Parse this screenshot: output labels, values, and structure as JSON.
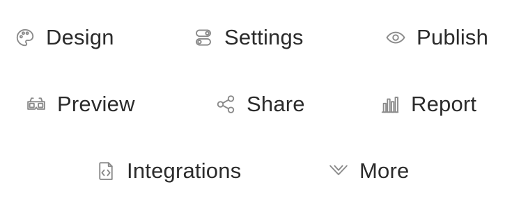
{
  "nav": {
    "items": [
      {
        "label": "Design",
        "icon": "palette-icon"
      },
      {
        "label": "Settings",
        "icon": "toggles-icon"
      },
      {
        "label": "Publish",
        "icon": "eye-icon"
      },
      {
        "label": "Preview",
        "icon": "3d-glasses-icon"
      },
      {
        "label": "Share",
        "icon": "share-nodes-icon"
      },
      {
        "label": "Report",
        "icon": "bar-chart-icon"
      },
      {
        "label": "Integrations",
        "icon": "code-file-icon"
      },
      {
        "label": "More",
        "icon": "chevron-down-double-icon"
      }
    ]
  },
  "colors": {
    "icon": "#8a8a8a",
    "text": "#2b2b2b",
    "background": "#ffffff"
  }
}
